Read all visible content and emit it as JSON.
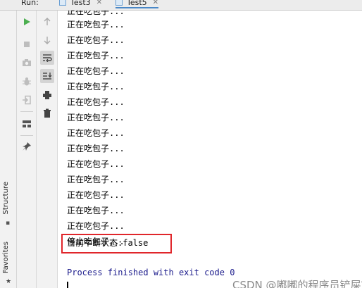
{
  "tabbar": {
    "run_label": "Run:",
    "tabs": [
      {
        "label": "Test3",
        "close": "✕"
      },
      {
        "label": "Test5",
        "close": "✕"
      }
    ]
  },
  "left_bar": {
    "structure": "Structure",
    "favorites": "Favorites"
  },
  "toolbar": {
    "run_icon": "play-icon",
    "stop_icon": "stop-icon",
    "up_icon": "arrow-up-icon",
    "down_icon": "arrow-down-icon",
    "wrap_icon": "soft-wrap-icon",
    "scroll_icon": "scroll-to-end-icon",
    "print_icon": "print-icon",
    "trash_icon": "trash-icon",
    "camera_icon": "camera-icon",
    "debug_icon": "bug-icon",
    "login_icon": "login-icon",
    "layout_icon": "layout-icon",
    "pin_icon": "pin-icon"
  },
  "console": {
    "lines": [
      "正在吃包子...",
      "正在吃包子...",
      "正在吃包子...",
      "正在吃包子...",
      "正在吃包子...",
      "正在吃包子...",
      "正在吃包子...",
      "正在吃包子...",
      "正在吃包子...",
      "正在吃包子...",
      "正在吃包子...",
      "正在吃包子...",
      "正在吃包子...",
      "正在吃包子...",
      "停止吃包子..."
    ],
    "top_partial": "正在吃包子...",
    "status_line": "当前中断状态:false",
    "process_line": "Process finished with exit code 0"
  },
  "watermark": "CSDN @嘟嘟的程序员铲屎官"
}
